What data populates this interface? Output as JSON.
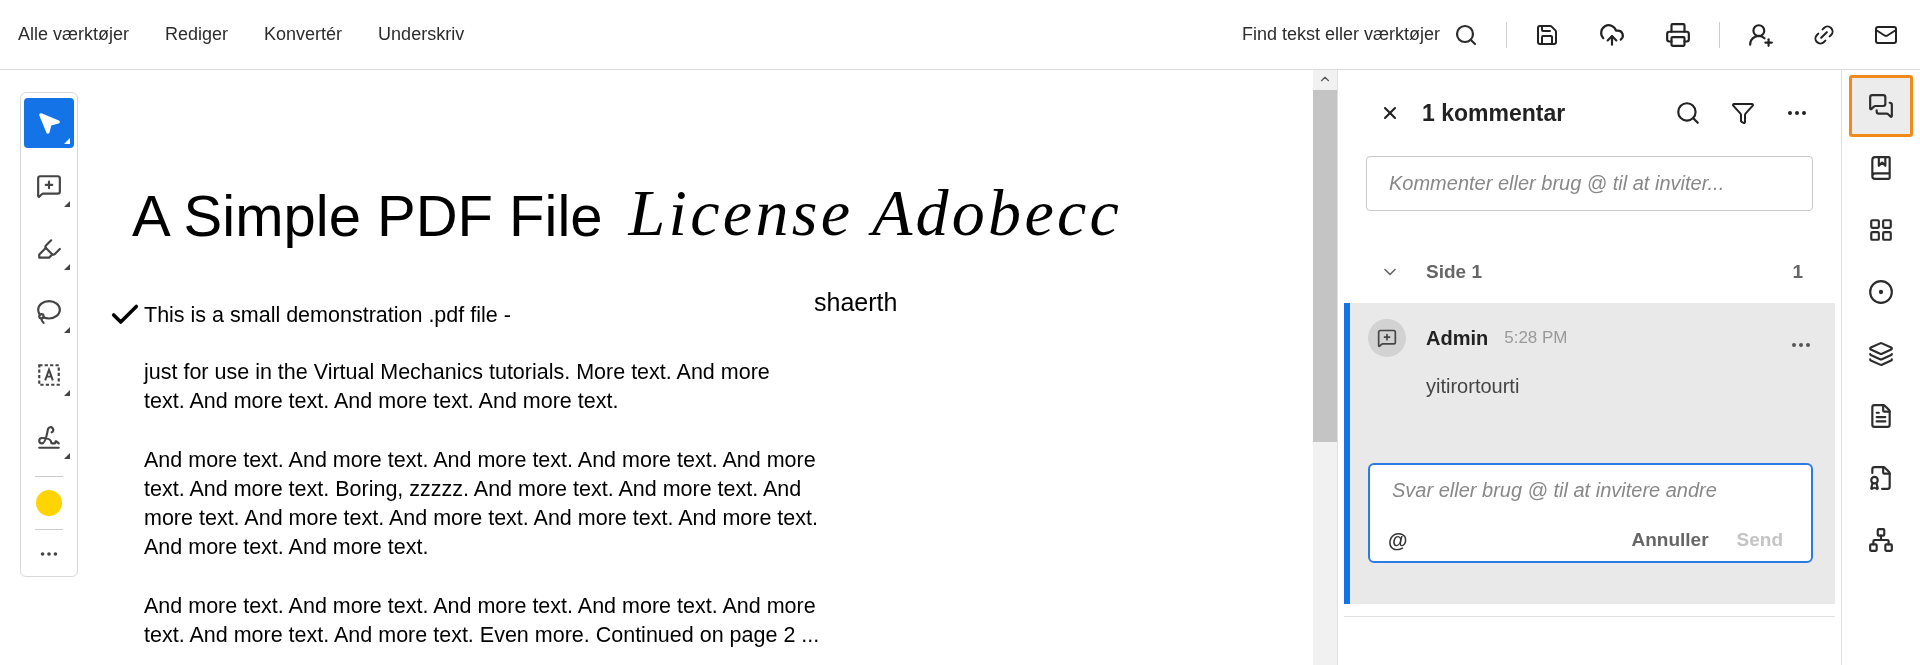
{
  "top_nav": [
    {
      "label": "Alle værktøjer"
    },
    {
      "label": "Rediger"
    },
    {
      "label": "Konvertér"
    },
    {
      "label": "Underskriv"
    }
  ],
  "search": {
    "label": "Find tekst eller værktøjer"
  },
  "toolbar": {
    "tools": [
      {
        "selected": true
      },
      {
        "selected": false
      },
      {
        "selected": false
      },
      {
        "selected": false
      },
      {
        "selected": false
      },
      {
        "selected": false
      }
    ],
    "color": "#ffd400"
  },
  "document": {
    "title": "A Simple PDF File",
    "signature": "License Adobecc",
    "signer": "shaerth",
    "checked_line": "This is a small demonstration .pdf file -",
    "paragraphs": [
      "just for use in the Virtual Mechanics tutorials. More text. And more\ntext. And more text. And more text. And more text.",
      "And more text. And more text. And more text. And more text. And more\ntext. And more text. Boring, zzzzz. And more text. And more text. And\nmore text. And more text. And more text. And more text. And more text.\nAnd more text. And more text.",
      "And more text. And more text. And more text. And more text. And more\ntext. And more text. And more text. Even more. Continued on page 2 ..."
    ]
  },
  "comments_panel": {
    "title": "1 kommentar",
    "input": {
      "placeholder": "Kommenter eller brug @ til at inviter..."
    },
    "group": {
      "label": "Side 1",
      "count": "1",
      "expanded": true
    },
    "comment": {
      "author": "Admin",
      "time": "5:28 PM",
      "text": "yitirortourti",
      "reply": {
        "placeholder": "Svar eller brug @ til at invitere andre",
        "mention": "@",
        "cancel": "Annuller",
        "send": "Send",
        "send_disabled": true
      }
    }
  },
  "rail": [
    {
      "selected": true
    },
    {
      "selected": false
    },
    {
      "selected": false
    },
    {
      "selected": false
    },
    {
      "selected": false
    },
    {
      "selected": false
    },
    {
      "selected": false
    },
    {
      "selected": false
    }
  ]
}
